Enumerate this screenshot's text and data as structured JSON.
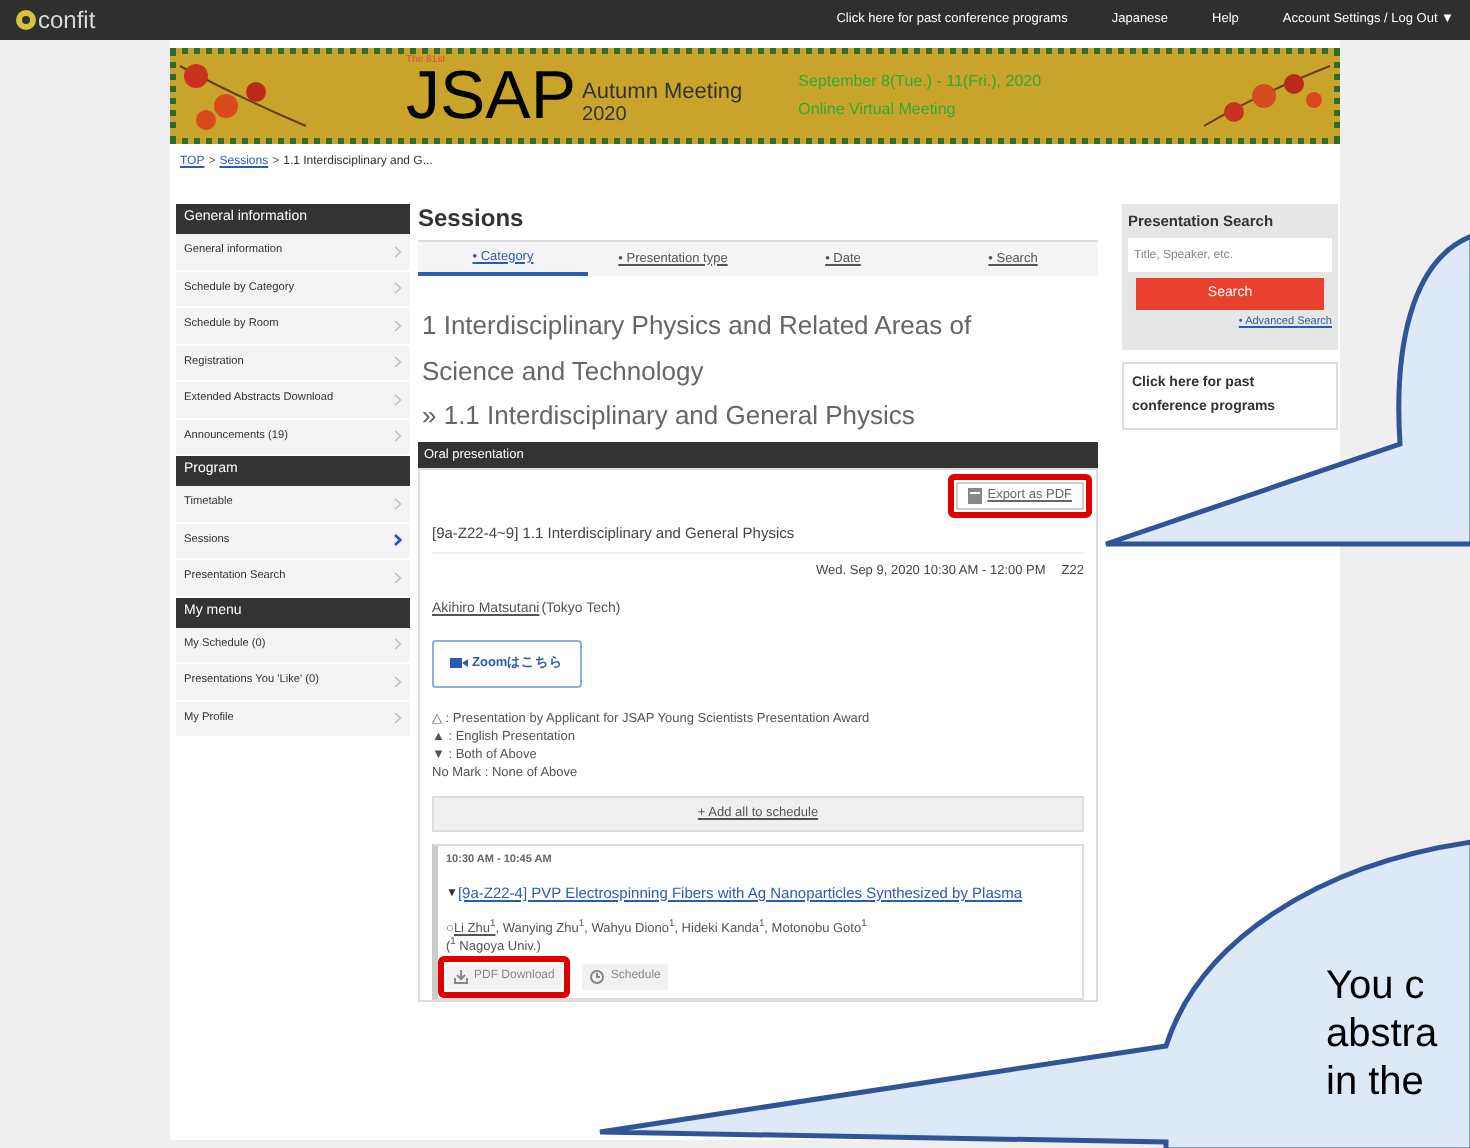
{
  "top_bar": {
    "logo": "confit",
    "links": [
      "Click here for past conference programs",
      "Japanese",
      "Help",
      "Account Settings / Log Out ▼"
    ]
  },
  "banner": {
    "edition": "The 81st",
    "acronym": "JSAP",
    "event": "Autumn Meeting",
    "year": "2020",
    "dates": "September 8(Tue.) - 11(Fri.), 2020",
    "venue": "Online Virtual Meeting"
  },
  "breadcrumb_separator": ">",
  "breadcrumb": [
    {
      "label": "TOP",
      "link": true
    },
    {
      "label": "Sessions",
      "link": true
    },
    {
      "label": "1.1 Interdisciplinary and G...",
      "link": false
    }
  ],
  "sidebar": [
    {
      "header": "General information",
      "items": [
        {
          "label": "General information",
          "selected": false
        },
        {
          "label": "Schedule by Category",
          "selected": false
        },
        {
          "label": "Schedule by Room",
          "selected": false
        },
        {
          "label": "Registration",
          "selected": false
        },
        {
          "label": "Extended Abstracts Download",
          "selected": false
        },
        {
          "label": "Announcements (19)",
          "selected": false
        }
      ]
    },
    {
      "header": "Program",
      "items": [
        {
          "label": "Timetable",
          "selected": false
        },
        {
          "label": "Sessions",
          "selected": true
        },
        {
          "label": "Presentation Search",
          "selected": false
        }
      ]
    },
    {
      "header": "My menu",
      "items": [
        {
          "label": "My Schedule (0)",
          "selected": false
        },
        {
          "label": "Presentations You 'Like' (0)",
          "selected": false
        },
        {
          "label": "My Profile",
          "selected": false
        }
      ]
    }
  ],
  "main": {
    "title": "Sessions",
    "tabs": [
      {
        "label": "• Category",
        "selected": true
      },
      {
        "label": "• Presentation type",
        "selected": false
      },
      {
        "label": "• Date",
        "selected": false
      },
      {
        "label": "• Search",
        "selected": false
      }
    ],
    "category": "1 Interdisciplinary Physics and Related Areas of Science and Technology",
    "subcategory": "» 1.1 Interdisciplinary and General Physics",
    "session": {
      "header": "Oral presentation",
      "export": "Export as PDF",
      "title": "[9a-Z22-4~9] 1.1 Interdisciplinary and General Physics",
      "datetime": "Wed. Sep 9, 2020 10:30 AM - 12:00 PM",
      "room": "Z22",
      "chair": "Akihiro Matsutani",
      "chair_affiliation": "(Tokyo Tech)",
      "zoom_button": "Zoomはこちら",
      "legend": [
        {
          "mark": "△",
          "text": ": Presentation by Applicant for JSAP Young Scientists Presentation Award"
        },
        {
          "mark": "▲",
          "text": ": English Presentation"
        },
        {
          "mark": "▼",
          "text": ": Both of Above"
        },
        {
          "mark": "No Mark",
          "text": ": None of Above"
        }
      ],
      "add_all": "+ Add all to schedule",
      "presentations": [
        {
          "time": "10:30 AM - 10:45 AM",
          "mark": "▼",
          "title": "[9a-Z22-4] PVP Electrospinning Fibers with Ag Nanoparticles Synthesized by Plasma",
          "presenter_marker": "○",
          "presenter": "Li Zhu$^{1}$",
          "authors": ", Wanying Zhu$^{1}$, Wahyu Diono$^{1}$, Hideki Kanda$^{1}$, Motonobu Goto$^{1}$",
          "affiliation": "($^{1}$ Nagoya Univ.)",
          "buttons": [
            "PDF Download",
            "Schedule"
          ]
        }
      ]
    }
  },
  "right": {
    "search": {
      "title": "Presentation Search",
      "placeholder": "Title, Speaker, etc.",
      "button": "Search",
      "advanced": "• Advanced Search"
    },
    "past": "Click here for past conference programs"
  },
  "callout": {
    "lines": [
      "You c",
      "abstra",
      "in the"
    ]
  }
}
